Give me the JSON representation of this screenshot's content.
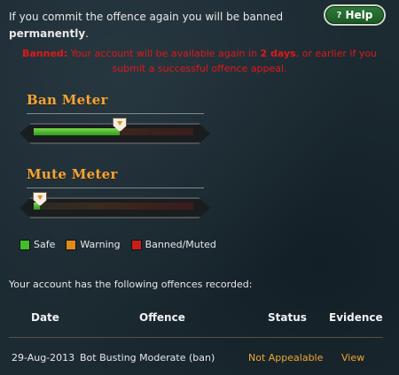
{
  "warning": {
    "line1": "If you commit the offence again you will be banned",
    "line2_bold": "permanently",
    "line2_suffix": "."
  },
  "help_button": {
    "label": "Help",
    "icon": "question-icon"
  },
  "ban_notice": {
    "label": "Banned:",
    "text_before": " Your account will be available again in ",
    "duration": "2 days",
    "text_after": ", or earlier if you submit a successful offence appeal."
  },
  "ban_meter": {
    "title": "Ban Meter",
    "level_percent": 54
  },
  "mute_meter": {
    "title": "Mute Meter",
    "level_percent": 4
  },
  "legend": [
    {
      "label": "Safe",
      "color": "#3fbf2a"
    },
    {
      "label": "Warning",
      "color": "#e08a1a"
    },
    {
      "label": "Banned/Muted",
      "color": "#c81e1e"
    }
  ],
  "offences_intro": "Your account has the following offences recorded:",
  "table": {
    "headers": {
      "date": "Date",
      "offence": "Offence",
      "status": "Status",
      "evidence": "Evidence"
    },
    "rows": [
      {
        "date": "29-Aug-2013",
        "offence": "Bot Busting Moderate (ban)",
        "status": "Not Appealable",
        "evidence": "View"
      }
    ]
  },
  "colors": {
    "accent_orange": "#f0a830",
    "ban_red": "#e01818",
    "help_green": "#2f7a3a"
  }
}
